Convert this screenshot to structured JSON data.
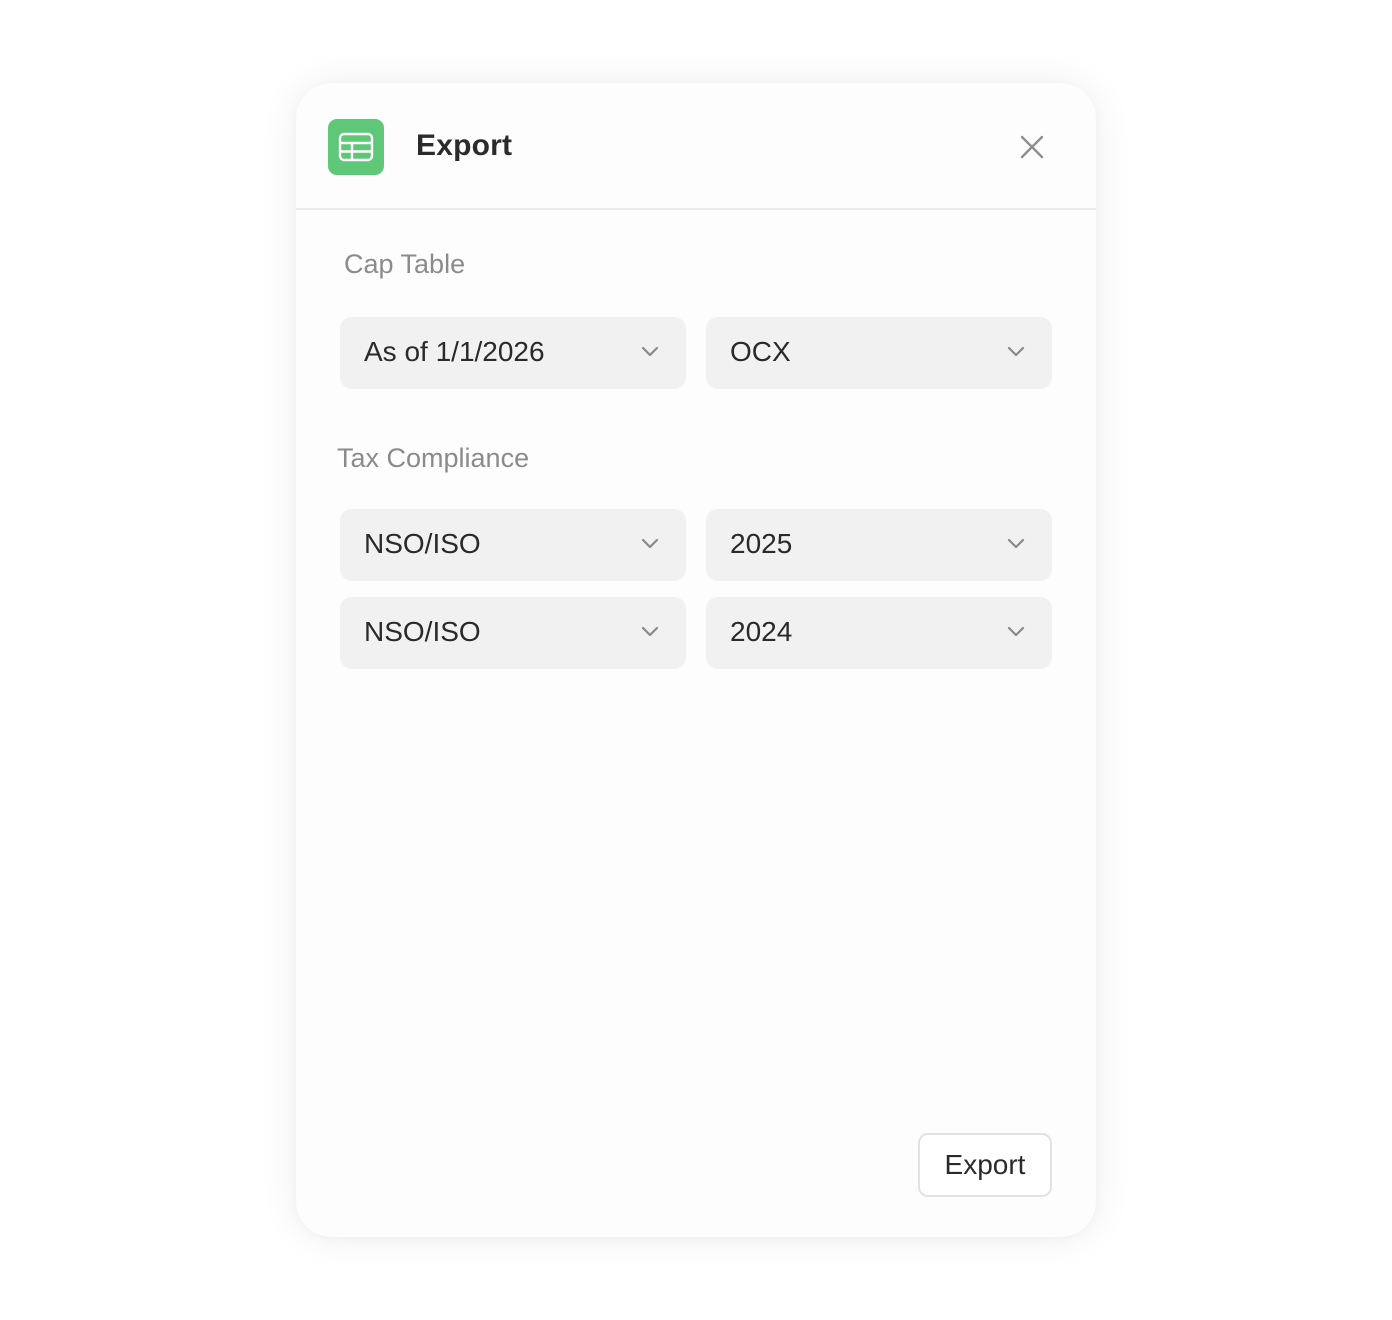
{
  "dialog": {
    "title": "Export",
    "app_icon": "spreadsheet-icon",
    "close_icon": "close-icon"
  },
  "cap_table": {
    "label": "Cap Table",
    "date_select": "As of 1/1/2026",
    "format_select": "OCX"
  },
  "tax_compliance": {
    "label": "Tax Compliance",
    "rows": [
      {
        "type": "NSO/ISO",
        "year": "2025"
      },
      {
        "type": "NSO/ISO",
        "year": "2024"
      }
    ]
  },
  "footer": {
    "export_label": "Export"
  },
  "colors": {
    "accent_green": "#5ec778",
    "select_bg": "#f1f1f1",
    "label_gray": "#8b8b8b"
  }
}
